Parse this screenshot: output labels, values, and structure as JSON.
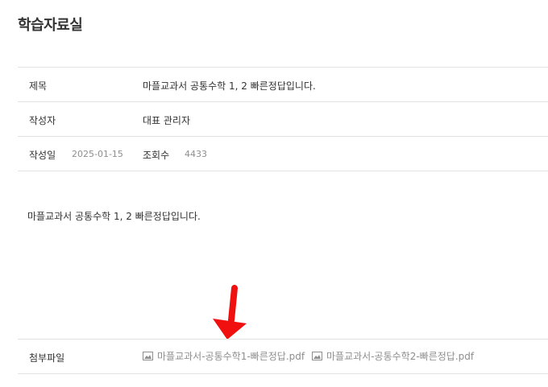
{
  "page": {
    "title": "학습자료실"
  },
  "meta": {
    "title_label": "제목",
    "title_value": "마플교과서 공통수학 1, 2 빠른정답입니다.",
    "author_label": "작성자",
    "author_value": "대표 관리자",
    "date_label": "작성일",
    "date_value": "2025-01-15",
    "views_label": "조회수",
    "views_value": "4433"
  },
  "content": {
    "body": "마플교과서 공통수학 1, 2 빠른정답입니다."
  },
  "attachments": {
    "label": "첨부파일",
    "files": [
      {
        "name": "마플교과서-공통수학1-빠른정답.pdf",
        "icon": "image-icon"
      },
      {
        "name": "마플교과서-공통수학2-빠른정답.pdf",
        "icon": "image-icon"
      }
    ]
  },
  "annotation": {
    "arrow_color": "#f01010",
    "arrow_icon": "red-arrow-down-icon"
  }
}
